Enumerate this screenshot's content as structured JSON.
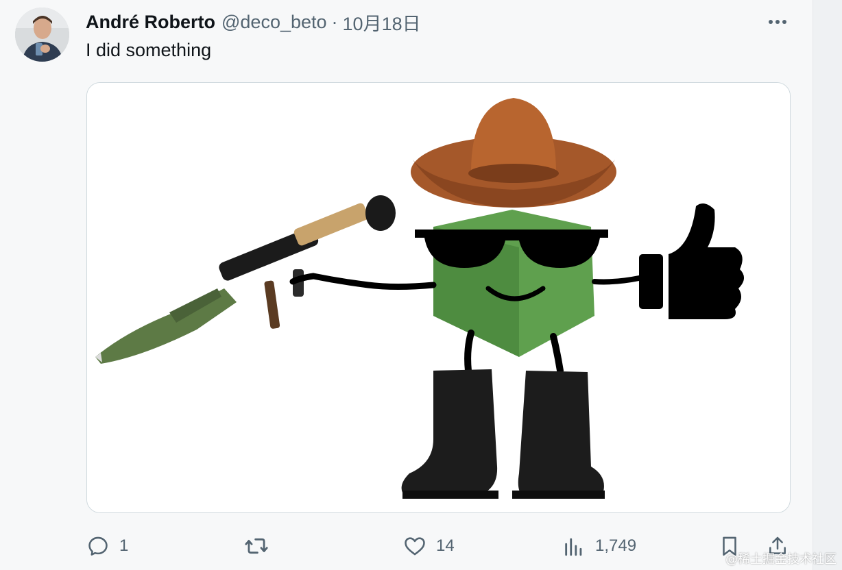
{
  "author": {
    "name": "André Roberto",
    "handle": "@deco_beto",
    "separator": "·",
    "date": "10月18日"
  },
  "tweet": {
    "text": "I did something"
  },
  "actions": {
    "reply_count": "1",
    "retweet_count": "",
    "like_count": "14",
    "views_count": "1,749"
  },
  "icons": {
    "more": "more-horizontal-icon",
    "reply": "reply-icon",
    "retweet": "retweet-icon",
    "like": "heart-icon",
    "views": "views-chart-icon",
    "bookmark": "bookmark-icon",
    "share": "share-icon"
  },
  "colors": {
    "text": "#0f1419",
    "secondary": "#536471",
    "border": "#cfd9de",
    "node_green": "#5fa04e"
  },
  "watermark": "@稀土掘金技术社区"
}
